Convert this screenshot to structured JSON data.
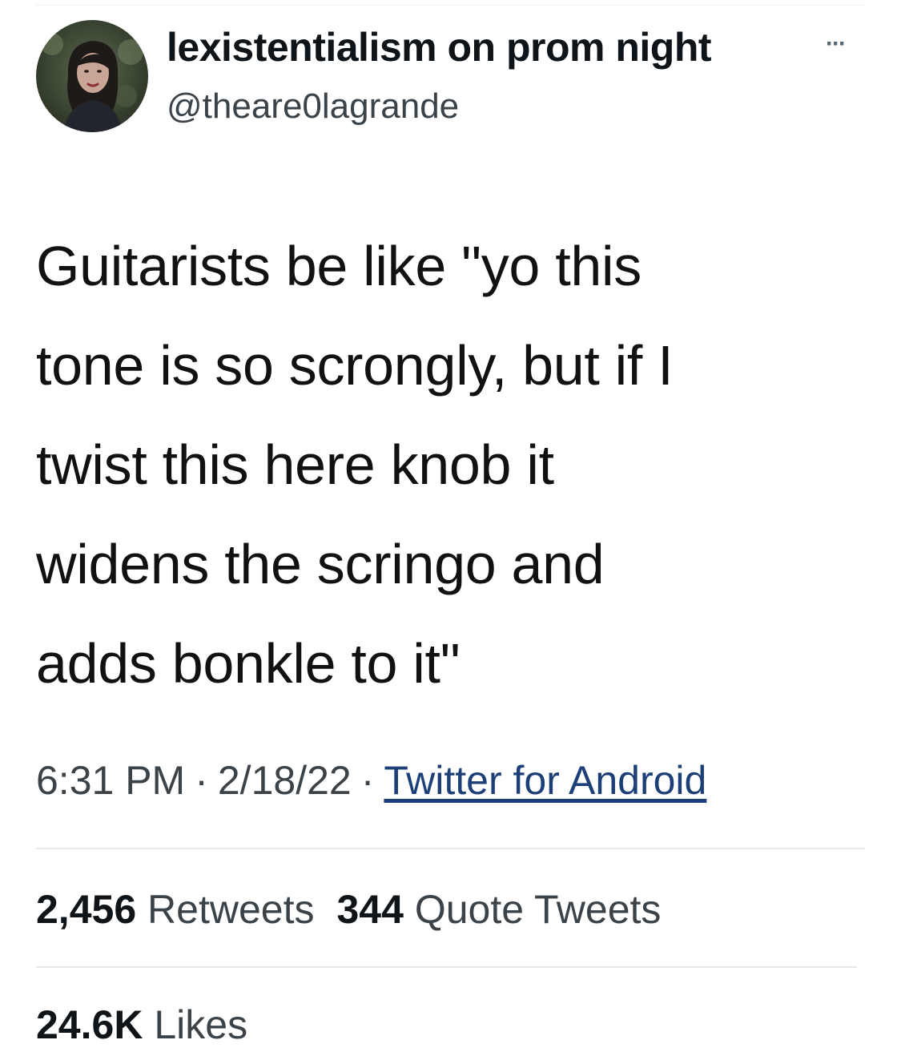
{
  "author": {
    "display_name": "lexistentialism on prom night",
    "handle": "@theare0lagrande",
    "more_icon": "more-options-icon"
  },
  "tweet": {
    "lines": [
      "Guitarists be like \"yo this",
      "tone is so scrongly, but if I",
      "twist this here knob it",
      "widens the scringo and",
      "adds bonkle to it\""
    ],
    "time": "6:31 PM",
    "date": "2/18/22",
    "source": "Twitter for Android",
    "separator": "·"
  },
  "stats": {
    "retweets_count": "2,456",
    "retweets_label": "Retweets",
    "quotes_count": "344",
    "quotes_label": "Quote Tweets",
    "likes_count": "24.6K",
    "likes_label": "Likes"
  },
  "colors": {
    "text": "#0f1419",
    "secondary": "#3b4248",
    "link": "#1c3f78",
    "divider": "#e6e8ea"
  }
}
